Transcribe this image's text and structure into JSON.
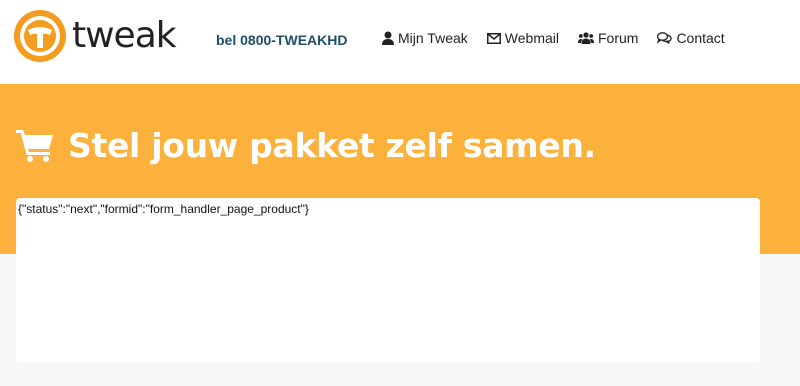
{
  "header": {
    "logo_text": "tweak",
    "phone": "bel 0800-TWEAKHD",
    "nav": [
      {
        "label": "Mijn Tweak",
        "icon": "user-icon"
      },
      {
        "label": "Webmail",
        "icon": "envelope-icon"
      },
      {
        "label": "Forum",
        "icon": "users-icon"
      },
      {
        "label": "Contact",
        "icon": "chat-icon"
      }
    ]
  },
  "hero": {
    "title": "Stel jouw pakket zelf samen.",
    "icon": "cart-icon"
  },
  "panel": {
    "raw_text": "{\"status\":\"next\",\"formid\":\"form_handler_page_product\"}"
  },
  "colors": {
    "accent": "#fbb13b",
    "phone": "#1d4f6b",
    "page_bg": "#f7f7f7"
  }
}
